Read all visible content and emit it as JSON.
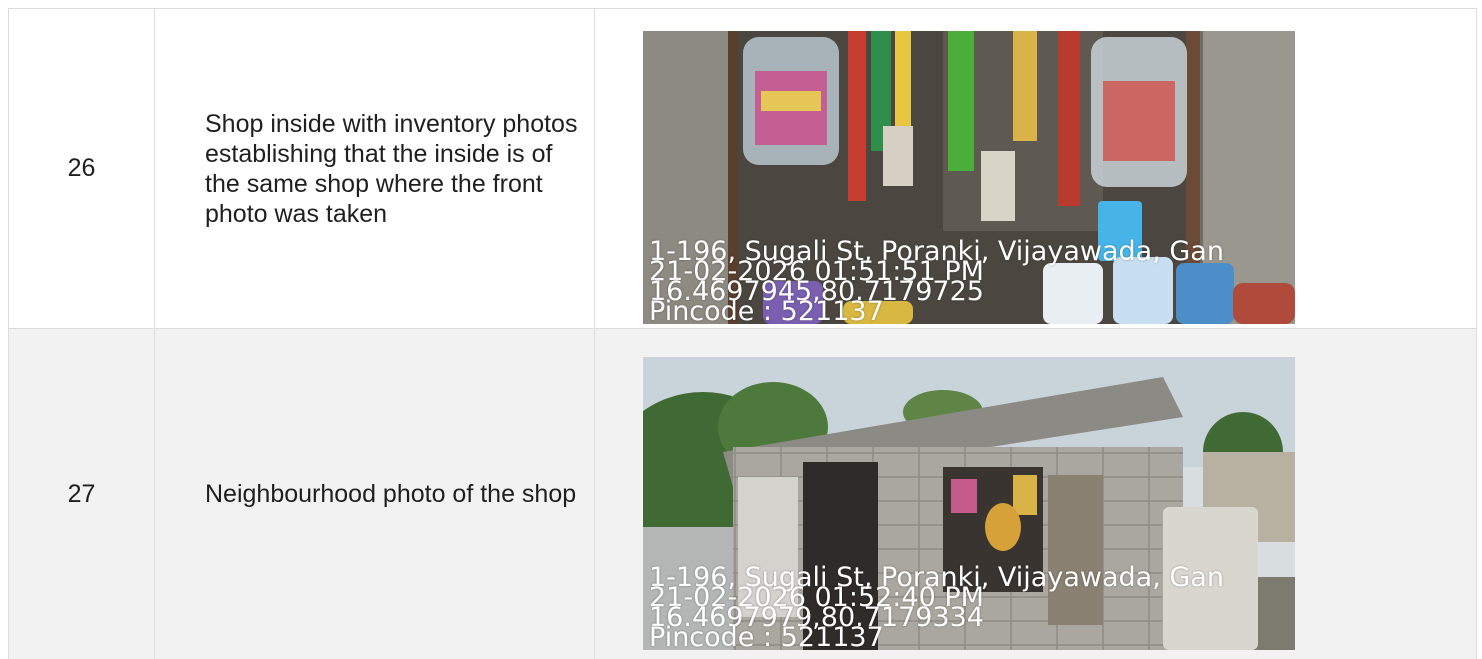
{
  "rows": [
    {
      "number": "26",
      "description": "Shop inside with inventory photos establishing that the inside is of the same shop where the front photo was taken",
      "photo": {
        "subject": "shop-interior",
        "stamp": {
          "address": "1-196, Sugali St, Poranki, Vijayawada, Gan",
          "datetime": "21-02-2026 01:51:51 PM",
          "coords": "16.4697945,80.7179725",
          "pincode": "Pincode : 521137"
        }
      }
    },
    {
      "number": "27",
      "description": "Neighbourhood photo of the shop",
      "photo": {
        "subject": "shop-exterior",
        "stamp": {
          "address": "1-196, Sugali St, Poranki, Vijayawada, Gan",
          "datetime": "21-02-2026 01:52:40 PM",
          "coords": "16.4697979,80.7179334",
          "pincode": "Pincode : 521137"
        }
      }
    }
  ],
  "colors": {
    "border": "#dcdcdc",
    "row_alt_bg": "#f2f2f2",
    "text": "#1f1f1f",
    "stamp_text": "#ffffff"
  }
}
